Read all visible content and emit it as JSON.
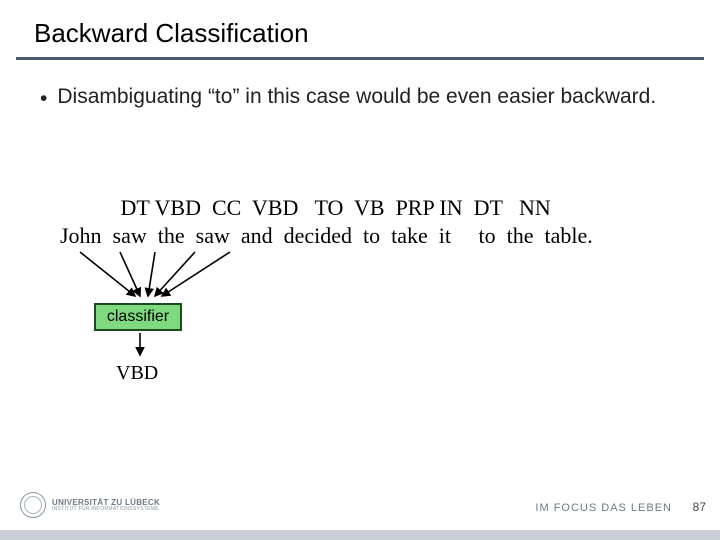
{
  "title": "Backward Classification",
  "bullet": "Disambiguating “to” in this case would be even easier backward.",
  "sentence": {
    "tags_line": "           DT VBD  CC  VBD   TO  VB  PRP IN  DT   NN",
    "words_line": "John  saw  the  saw  and  decided  to  take  it     to  the  table."
  },
  "classifier_label": "classifier",
  "output_tag": "VBD",
  "footer": {
    "uni_line1": "UNIVERSITÄT ZU LÜBECK",
    "uni_line2": "INSTITUT FÜR INFORMATIONSSYSTEME",
    "right": "IM FOCUS DAS LEBEN",
    "page": "87"
  }
}
